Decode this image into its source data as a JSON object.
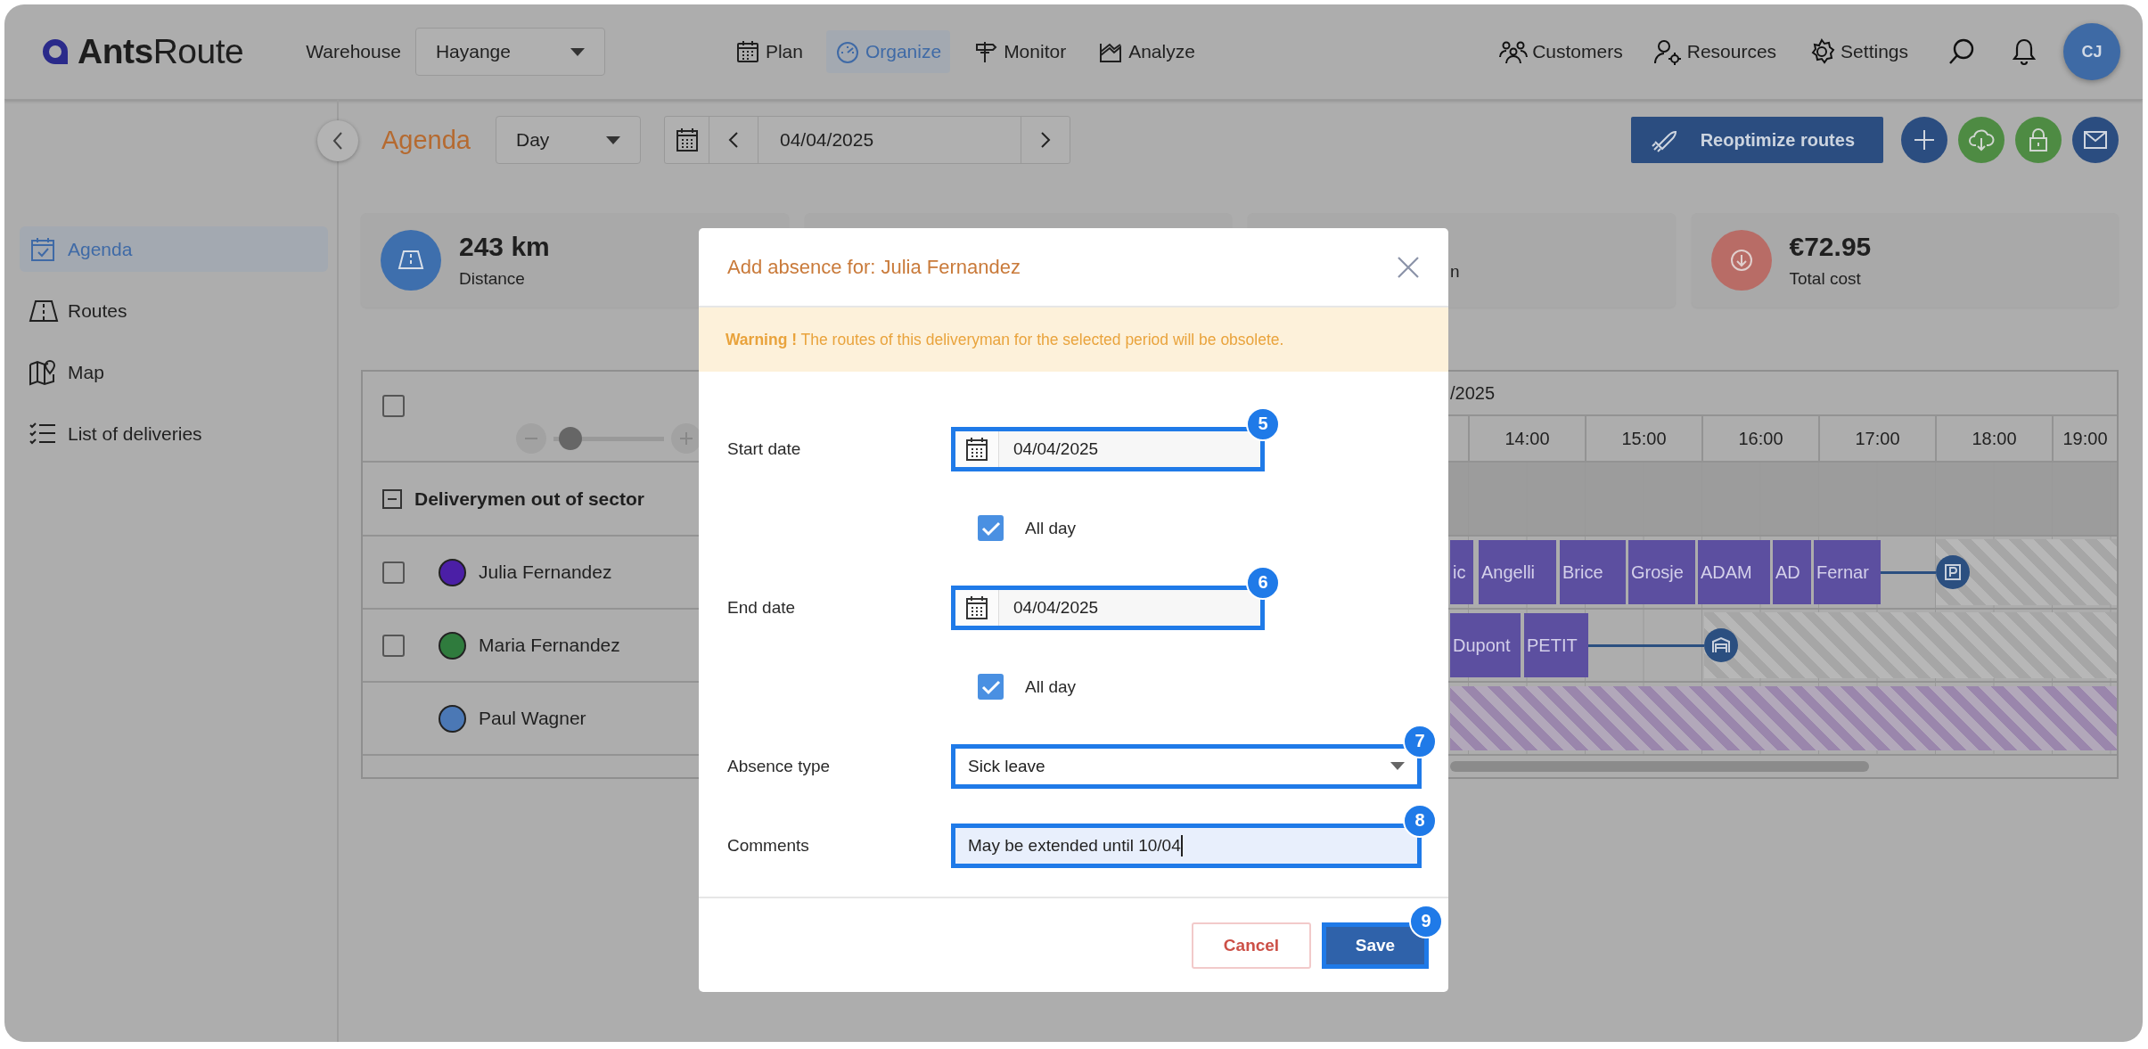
{
  "header": {
    "logo": "**Ants**Route",
    "warehouse_label": "Warehouse",
    "warehouse": "Hayange",
    "nav": [
      {
        "label": "Plan",
        "selected": false
      },
      {
        "label": "Organize",
        "selected": true
      },
      {
        "label": "Monitor",
        "selected": false
      },
      {
        "label": "Analyze",
        "selected": false
      }
    ],
    "links": [
      "Customers",
      "Resources",
      "Settings"
    ],
    "avatar": "CJ"
  },
  "toolbar": {
    "title": "Agenda",
    "view": "Day",
    "date": "04/04/2025",
    "action": "Reoptimize routes"
  },
  "sidebar": [
    {
      "label": "Agenda",
      "selected": true
    },
    {
      "label": "Routes",
      "selected": false
    },
    {
      "label": "Map",
      "selected": false
    },
    {
      "label": "List of deliveries",
      "selected": false
    }
  ],
  "stats": [
    {
      "kind": "distance",
      "value": "243 km",
      "label": "Distance"
    },
    {
      "kind": "partial",
      "label": "n"
    },
    {
      "kind": "cost",
      "value": "€72.95",
      "label": "Total cost"
    }
  ],
  "table": {
    "checked": false,
    "zoom": {
      "level": 0.05
    },
    "date": "/2025",
    "hours": [
      "14:00",
      "15:00",
      "16:00",
      "17:00",
      "18:00",
      "19:00"
    ],
    "group": {
      "label": "Deliverymen out of sector",
      "expanded": true
    },
    "rows": [
      {
        "kind": "route",
        "name": "Julia Fernandez",
        "color": "#4b1fa6",
        "checked": false,
        "blocks": [
          "ic",
          "Angelli",
          "Brice",
          "Grosje",
          "ADAM",
          "AD",
          "Fernar"
        ]
      },
      {
        "kind": "route",
        "name": "Maria Fernandez",
        "color": "#2f7b3d",
        "checked": false,
        "blocks": [
          "Dupont",
          "PETIT"
        ]
      },
      {
        "kind": "absence",
        "name": "Paul Wagner",
        "color": "#4b78b5"
      }
    ]
  },
  "modal": {
    "title": "Add absence for: Julia Fernandez",
    "warning": "**Warning !** The routes of this deliveryman for the selected period will be obsolete.",
    "fields": [
      {
        "kind": "date",
        "label": "Start date",
        "value": "04/04/2025",
        "callout": "5"
      },
      {
        "kind": "checkbox",
        "label": "All day",
        "checked": true
      },
      {
        "kind": "date",
        "label": "End date",
        "value": "04/04/2025",
        "callout": "6"
      },
      {
        "kind": "checkbox",
        "label": "All day",
        "checked": true
      },
      {
        "kind": "select",
        "label": "Absence type",
        "value": "Sick leave",
        "callout": "7"
      },
      {
        "kind": "text",
        "label": "Comments",
        "value": "May be extended until 10/04",
        "callout": "8"
      }
    ],
    "cancel": "Cancel",
    "save": {
      "label": "Save",
      "callout": "9"
    }
  }
}
